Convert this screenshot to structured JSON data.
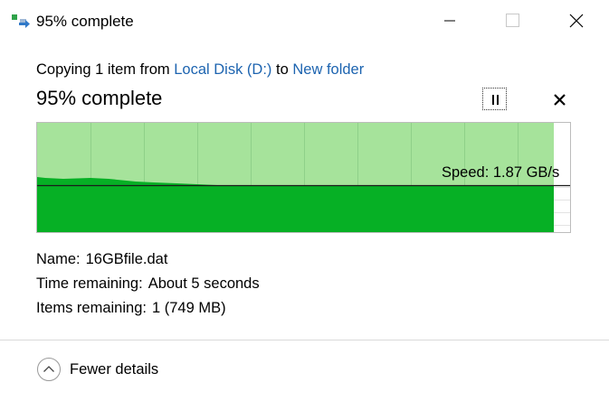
{
  "window": {
    "title": "95% complete",
    "controls": {
      "minimize": "minimize",
      "maximize": "maximize",
      "close": "close"
    }
  },
  "copy": {
    "prefix": "Copying 1 item from ",
    "source": "Local Disk (D:)",
    "connector": " to ",
    "destination": "New folder"
  },
  "status": {
    "headline": "95% complete",
    "progress_percent": 95
  },
  "graph": {
    "speed_label": "Speed: 1.87 GB/s",
    "colors": {
      "background_done": "#a6e39b",
      "fill": "#06b025",
      "remaining": "#ffffff",
      "grid": "#8fd089",
      "speed_line": "#000000"
    }
  },
  "details": {
    "name_label": "Name:",
    "name_value": "16GBfile.dat",
    "time_label": "Time remaining:",
    "time_value": "About 5 seconds",
    "items_label": "Items remaining:",
    "items_value": "1 (749 MB)"
  },
  "footer": {
    "toggle_label": "Fewer details"
  },
  "icons": {
    "app": "file-copy-icon",
    "pause": "pause-icon",
    "cancel": "close-icon",
    "toggle": "chevron-up-icon"
  }
}
